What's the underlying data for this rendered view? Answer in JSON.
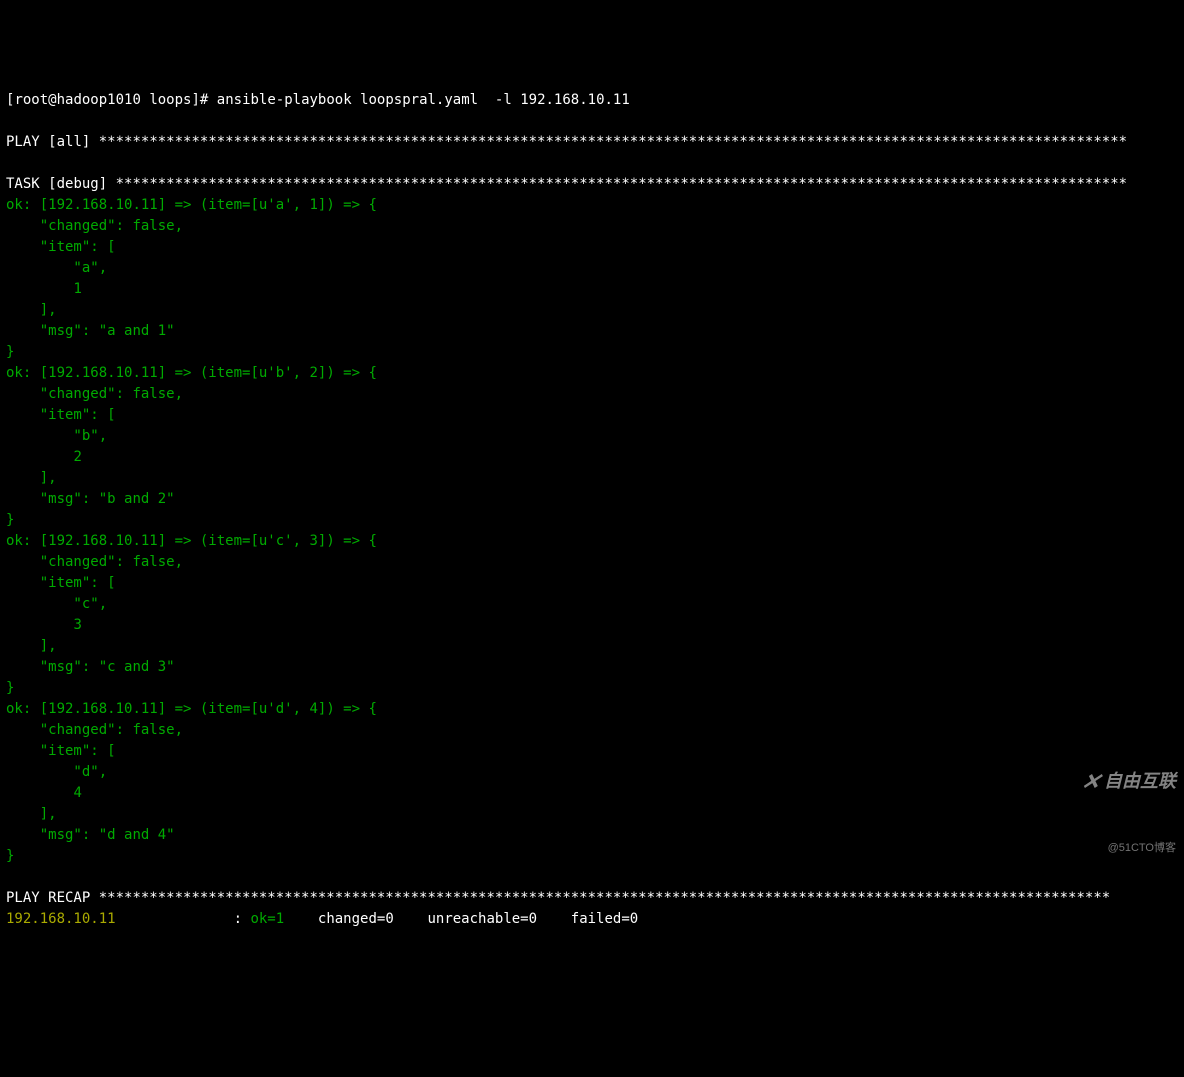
{
  "prompt": {
    "user": "root",
    "host": "hadoop1010",
    "dir": "loops",
    "command": "ansible-playbook loopspral.yaml  -l 192.168.10.11"
  },
  "play_header": {
    "label": "PLAY",
    "target": "[all]",
    "stars": "**************************************************************************************************************************"
  },
  "task_header": {
    "label": "TASK",
    "target": "[debug]",
    "stars": "************************************************************************************************************************"
  },
  "results": [
    {
      "host": "192.168.10.11",
      "item_raw": "[u'a', 1]",
      "changed": "false",
      "item_letter": "a",
      "item_number": "1",
      "msg": "a and 1"
    },
    {
      "host": "192.168.10.11",
      "item_raw": "[u'b', 2]",
      "changed": "false",
      "item_letter": "b",
      "item_number": "2",
      "msg": "b and 2"
    },
    {
      "host": "192.168.10.11",
      "item_raw": "[u'c', 3]",
      "changed": "false",
      "item_letter": "c",
      "item_number": "3",
      "msg": "c and 3"
    },
    {
      "host": "192.168.10.11",
      "item_raw": "[u'd', 4]",
      "changed": "false",
      "item_letter": "d",
      "item_number": "4",
      "msg": "d and 4"
    }
  ],
  "recap": {
    "label": "PLAY RECAP",
    "stars": "************************************************************************************************************************",
    "host": "192.168.10.11",
    "ok": "ok=1",
    "changed": "changed=0",
    "unreachable": "unreachable=0",
    "failed": "failed=0"
  },
  "watermark": {
    "main": "自由互联",
    "sub": "@51CTO博客"
  }
}
